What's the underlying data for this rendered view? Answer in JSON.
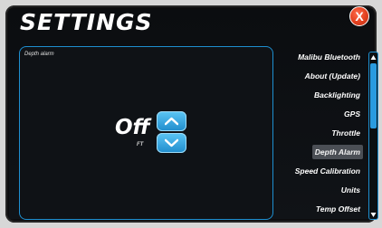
{
  "header": {
    "title": "SETTINGS",
    "close_label": "X"
  },
  "depth_alarm_panel": {
    "label": "Depth alarm",
    "value": "Off",
    "unit": "FT"
  },
  "menu": {
    "items": [
      {
        "label": "Malibu Bluetooth",
        "selected": false
      },
      {
        "label": "About (Update)",
        "selected": false
      },
      {
        "label": "Backlighting",
        "selected": false
      },
      {
        "label": "GPS",
        "selected": false
      },
      {
        "label": "Throttle",
        "selected": false
      },
      {
        "label": "Depth Alarm",
        "selected": true
      },
      {
        "label": "Speed Calibration",
        "selected": false
      },
      {
        "label": "Units",
        "selected": false
      },
      {
        "label": "Temp Offset",
        "selected": false
      }
    ]
  },
  "colors": {
    "accent": "#1e8fd0",
    "close": "#e2401f"
  }
}
